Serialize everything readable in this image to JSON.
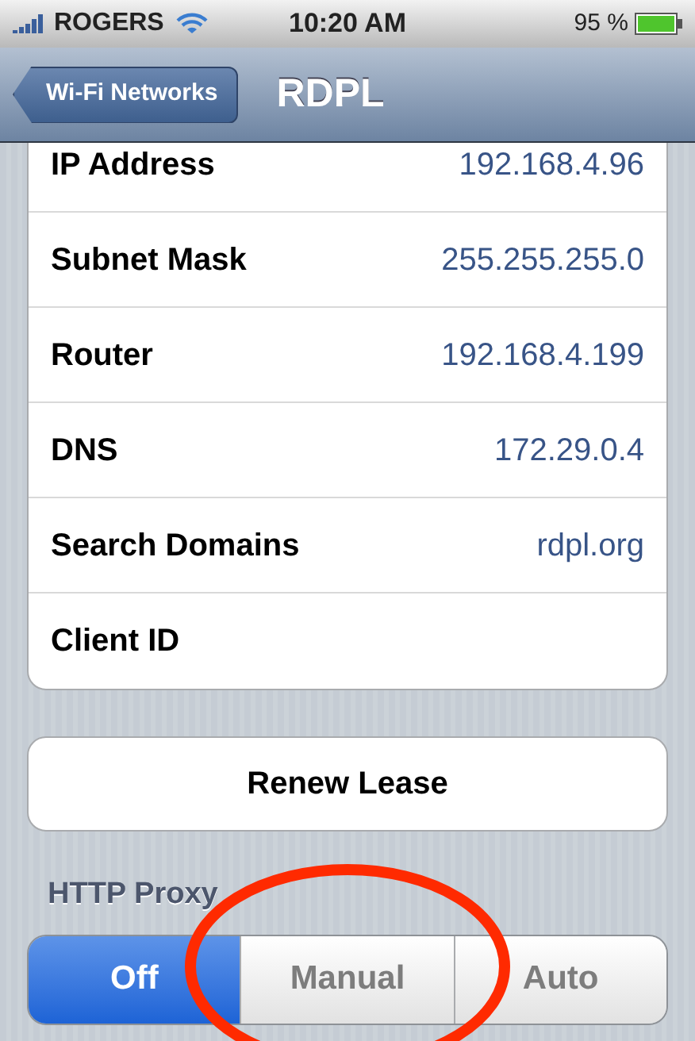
{
  "status_bar": {
    "carrier": "ROGERS",
    "time": "10:20 AM",
    "battery": "95 %"
  },
  "nav_bar": {
    "back_button": "Wi-Fi Networks",
    "title": "RDPL"
  },
  "rows": [
    {
      "label": "IP Address",
      "value": "192.168.4.96"
    },
    {
      "label": "Subnet Mask",
      "value": "255.255.255.0"
    },
    {
      "label": "Router",
      "value": "192.168.4.199"
    },
    {
      "label": "DNS",
      "value": "172.29.0.4"
    },
    {
      "label": "Search Domains",
      "value": "rdpl.org"
    },
    {
      "label": "Client ID"
    }
  ],
  "renew_button": "Renew Lease",
  "http_proxy": {
    "heading": "HTTP Proxy",
    "segments": [
      {
        "label": "Off",
        "selected": true
      },
      {
        "label": "Manual",
        "selected": false
      },
      {
        "label": "Auto",
        "selected": false
      }
    ]
  }
}
